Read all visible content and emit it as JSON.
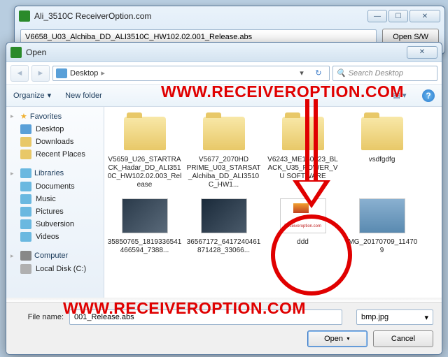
{
  "parent": {
    "title": "Ali_3510C ReceiverOption.com",
    "inputValue": "V6658_U03_Alchiba_DD_ALI3510C_HW102.02.001_Release.abs",
    "openSwLabel": "Open S/W"
  },
  "dialog": {
    "title": "Open",
    "breadcrumb": {
      "location": "Desktop"
    },
    "search": {
      "placeholder": "Search Desktop"
    },
    "toolbar": {
      "organize": "Organize",
      "newFolder": "New folder"
    },
    "sidebar": {
      "favorites": {
        "label": "Favorites",
        "items": [
          "Desktop",
          "Downloads",
          "Recent Places"
        ]
      },
      "libraries": {
        "label": "Libraries",
        "items": [
          "Documents",
          "Music",
          "Pictures",
          "Subversion",
          "Videos"
        ]
      },
      "computer": {
        "label": "Computer",
        "items": [
          "Local Disk (C:)"
        ]
      }
    },
    "items": [
      {
        "type": "folder",
        "label": "V5659_U26_STARTRACK_Hadar_DD_ALI3510C_HW102.02.003_Release"
      },
      {
        "type": "folder",
        "label": "V5677_2070HD PRIME_U03_STARSAT_Alchiba_DD_ALI3510C_HW1..."
      },
      {
        "type": "folder",
        "label": "V6243_ME160523_BLACK_U35_POWER_VU SOFTWARE"
      },
      {
        "type": "folder",
        "label": "vsdfgdfg"
      },
      {
        "type": "thumb1",
        "label": "35850765_1819336541466594_7388..."
      },
      {
        "type": "thumb2",
        "label": "36567172_6417240461871428_33066..."
      },
      {
        "type": "thumb3",
        "label": "ddd"
      },
      {
        "type": "thumb4",
        "label": "IMG_20170709_114709"
      }
    ],
    "fileName": {
      "label": "File name:",
      "value": "001_Release.abs",
      "filter": "bmp.jpg"
    },
    "buttons": {
      "open": "Open",
      "cancel": "Cancel"
    }
  },
  "watermark": "WWW.RECEIVEROPTION.COM"
}
